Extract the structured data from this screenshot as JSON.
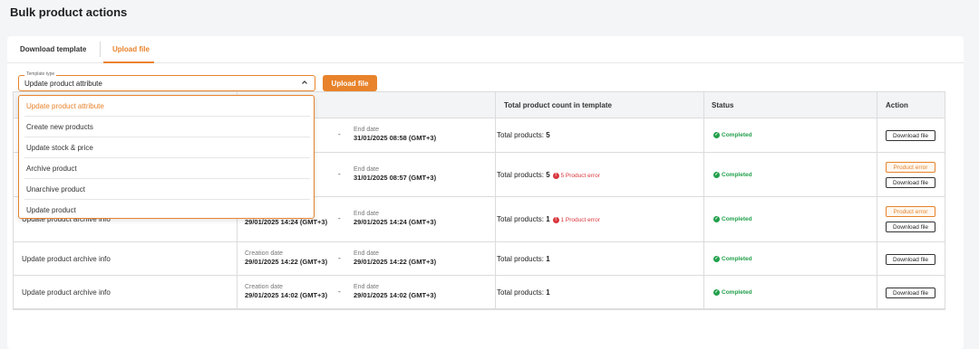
{
  "page": {
    "title": "Bulk product actions"
  },
  "tabs": [
    {
      "label": "Download template"
    },
    {
      "label": "Upload file"
    }
  ],
  "template_select": {
    "legend": "Template type",
    "value": "Update product attribute",
    "options": [
      "Update product attribute",
      "Create new products",
      "Update stock & price",
      "Archive product",
      "Unarchive product",
      "Update product"
    ]
  },
  "upload_button": "Upload file",
  "table": {
    "headers": [
      "Total product count in template",
      "Status",
      "Action"
    ],
    "rows": [
      {
        "type": "",
        "creation_label": "",
        "creation_value": "GMT+3)",
        "end_label": "End date",
        "end_value": "31/01/2025 08:58 (GMT+3)",
        "count_prefix": "Total products: ",
        "count": "5",
        "error_icon": "!",
        "error_text": "",
        "status": "Completed",
        "error_button": "",
        "download_button": "Download file"
      },
      {
        "type": "",
        "creation_label": "",
        "creation_value": "GMT+3)",
        "end_label": "End date",
        "end_value": "31/01/2025 08:57 (GMT+3)",
        "count_prefix": "Total products: ",
        "count": "5",
        "error_icon": "!",
        "error_text": "5 Product error",
        "status": "Completed",
        "error_button": "Product error",
        "download_button": "Download file"
      },
      {
        "type": "Update product archive info",
        "creation_label": "Creation date",
        "creation_value": "29/01/2025 14:24 (GMT+3)",
        "end_label": "End date",
        "end_value": "29/01/2025 14:24 (GMT+3)",
        "count_prefix": "Total products: ",
        "count": "1",
        "error_icon": "!",
        "error_text": "1 Product error",
        "status": "Completed",
        "error_button": "Product error",
        "download_button": "Download file"
      },
      {
        "type": "Update product archive info",
        "creation_label": "Creation date",
        "creation_value": "29/01/2025 14:22 (GMT+3)",
        "end_label": "End date",
        "end_value": "29/01/2025 14:22 (GMT+3)",
        "count_prefix": "Total products: ",
        "count": "1",
        "error_icon": "!",
        "error_text": "",
        "status": "Completed",
        "error_button": "",
        "download_button": "Download file"
      },
      {
        "type": "Update product archive info",
        "creation_label": "Creation date",
        "creation_value": "29/01/2025 14:02 (GMT+3)",
        "end_label": "End date",
        "end_value": "29/01/2025 14:02 (GMT+3)",
        "count_prefix": "Total products: ",
        "count": "1",
        "error_icon": "!",
        "error_text": "",
        "status": "Completed",
        "error_button": "",
        "download_button": "Download file"
      }
    ]
  },
  "colors": {
    "accent": "#e8832b",
    "success": "#22a04b",
    "error": "#d9363e"
  },
  "icons": {
    "select": "chevron-up-icon",
    "status": "check-circle-icon",
    "error": "error-circle-icon"
  }
}
